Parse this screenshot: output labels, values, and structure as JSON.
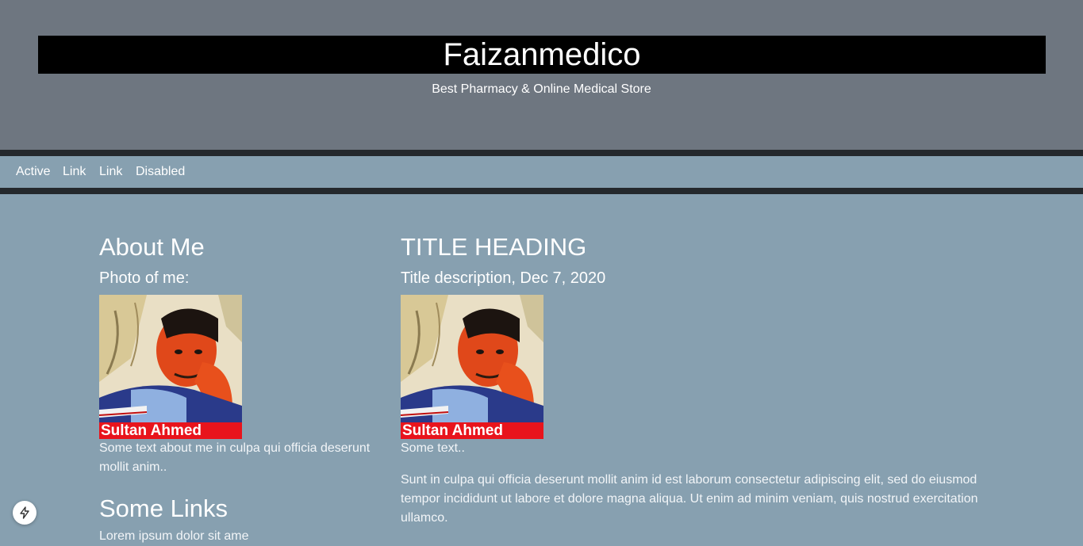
{
  "header": {
    "title": "Faizanmedico",
    "subtitle": "Best Pharmacy & Online Medical Store"
  },
  "nav": {
    "items": [
      {
        "label": "Active"
      },
      {
        "label": "Link"
      },
      {
        "label": "Link"
      },
      {
        "label": "Disabled"
      }
    ]
  },
  "sidebar": {
    "heading": "About Me",
    "photo_label": "Photo of me:",
    "photo_caption": "Sultan Ahmed",
    "about_text": "Some text about me in culpa qui officia deserunt mollit anim..",
    "links_heading": "Some Links",
    "links_text": "Lorem ipsum dolor sit ame"
  },
  "main": {
    "post_title": "TITLE HEADING",
    "post_description": "Title description, Dec 7, 2020",
    "photo_caption": "Sultan Ahmed",
    "short_text": "Some text..",
    "body_text": "Sunt in culpa qui officia deserunt mollit anim id est laborum consectetur adipiscing elit, sed do eiusmod tempor incididunt ut labore et dolore magna aliqua. Ut enim ad minim veniam, quis nostrud exercitation ullamco."
  },
  "colors": {
    "header_bg": "#6e7680",
    "page_bg": "#87a0b0",
    "title_bar_bg": "#000000",
    "nav_border": "#24282c",
    "caption_bg": "#e8141c"
  },
  "icons": {
    "fab": "lightning-icon"
  }
}
